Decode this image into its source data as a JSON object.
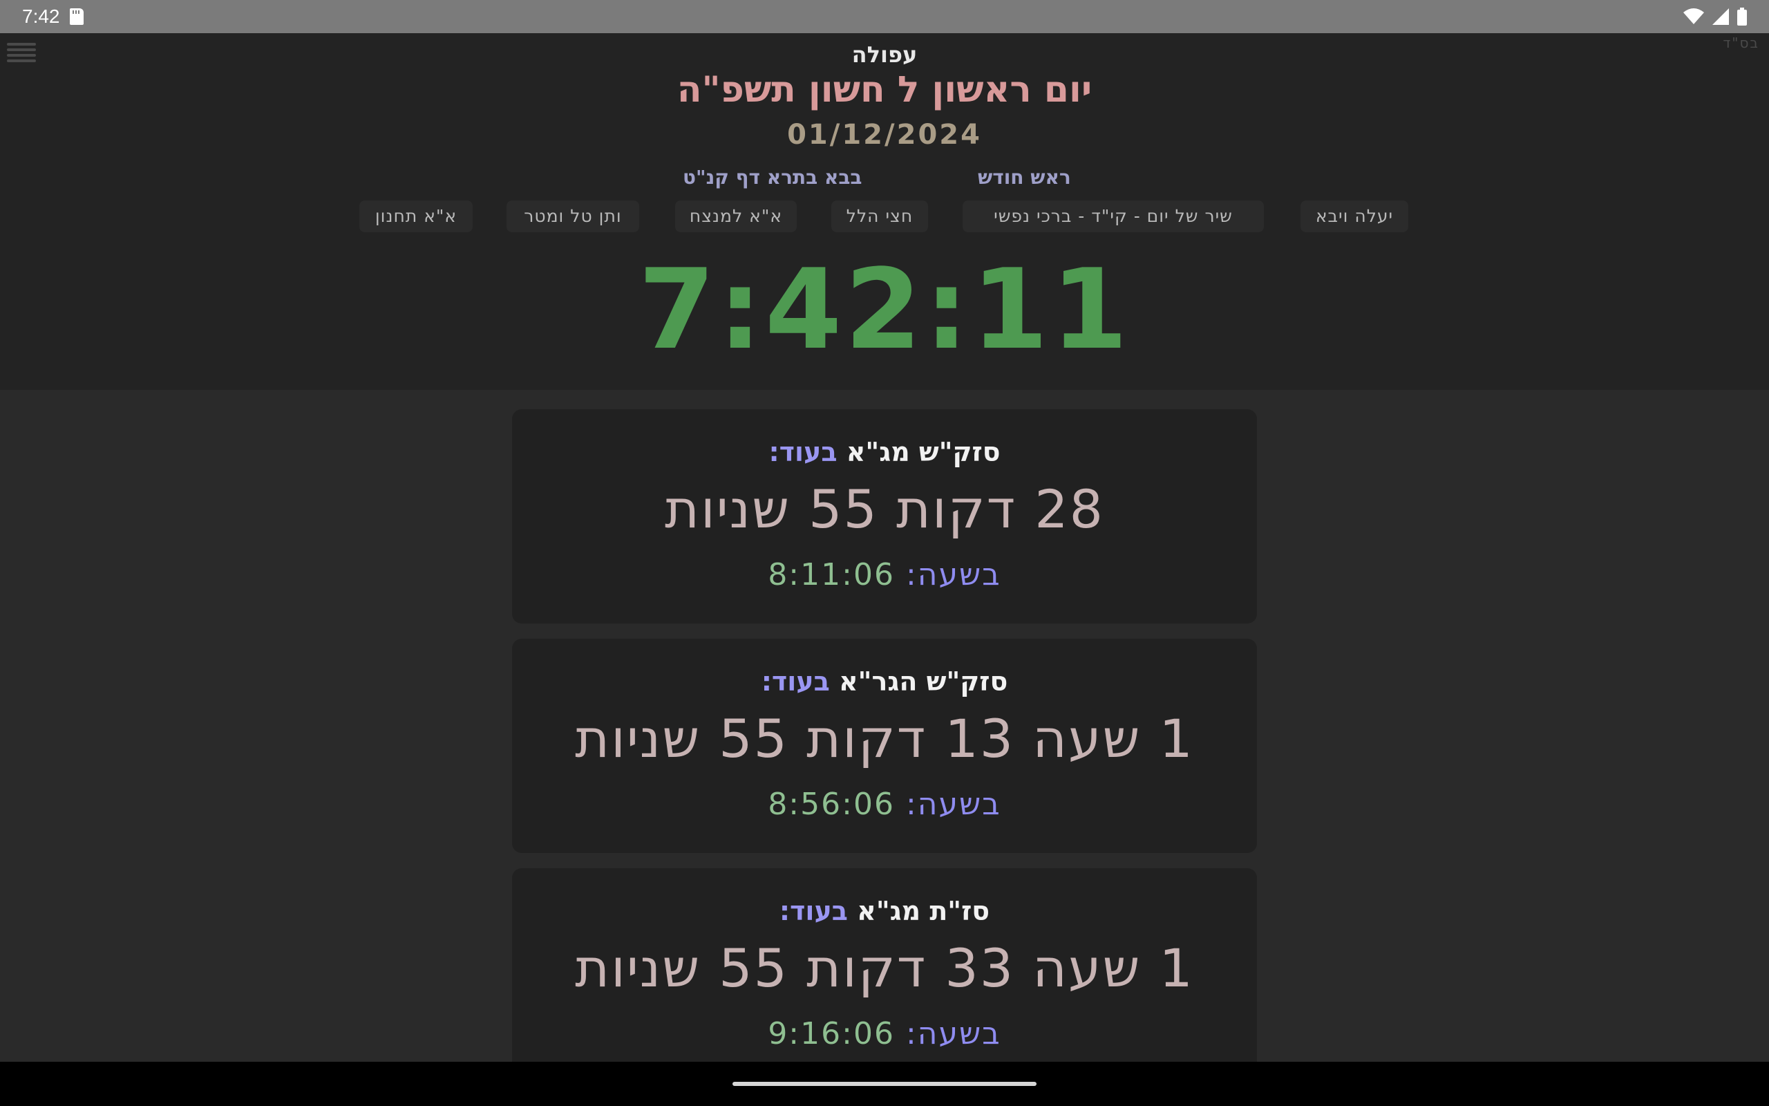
{
  "status_bar": {
    "time": "7:42"
  },
  "header": {
    "bsd": "בס\"ד",
    "location": "עפולה",
    "hebrew_date": "יום ראשון ל חשון תשפ\"ה",
    "gregorian_date": "01/12/2024",
    "rosh_chodesh": "ראש חודש",
    "daf_yomi": "בבא בתרא דף קנ\"ט",
    "tags": [
      "יעלה ויבא",
      "שיר של יום - קי\"ד - ברכי נפשי",
      "חצי הלל",
      "א\"א למנצח",
      "ותן טל ומטר",
      "א\"א תחנון"
    ],
    "clock": "7:42:11"
  },
  "cards": [
    {
      "title": "סזק\"ש מג\"א",
      "until_label": "בעוד:",
      "remaining": "28 דקות 55 שניות",
      "at_label": "בשעה:",
      "at_time": "8:11:06"
    },
    {
      "title": "סזק\"ש הגר\"א",
      "until_label": "בעוד:",
      "remaining": "1 שעה 13 דקות 55 שניות",
      "at_label": "בשעה:",
      "at_time": "8:56:06"
    },
    {
      "title": "סז\"ת מג\"א",
      "until_label": "בעוד:",
      "remaining": "1 שעה 33 דקות 55 שניות",
      "at_label": "בשעה:",
      "at_time": "9:16:06"
    }
  ],
  "colors": {
    "clock": "#4e9a51",
    "hebrew_date": "#d89a9a",
    "accent": "#9a96f2"
  }
}
